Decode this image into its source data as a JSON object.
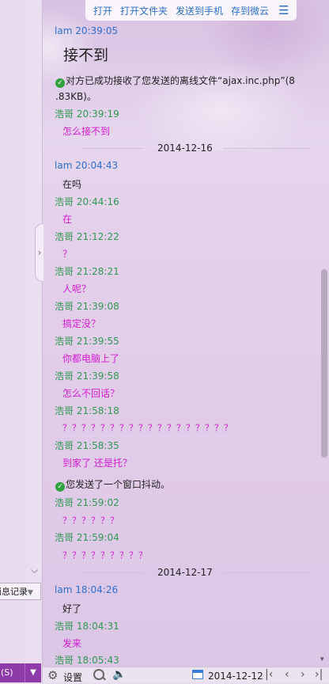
{
  "file_toolbar": {
    "open": "打开",
    "open_folder": "打开文件夹",
    "send_phone": "发送到手机",
    "save_cloud": "存到微云"
  },
  "left": {
    "history": "消息记录",
    "send_fragment": "(S)"
  },
  "messages": [
    {
      "sender": "lam",
      "time": "20:39:05",
      "text": "接不到",
      "role": "me",
      "big": true
    },
    {
      "system": true,
      "text1": "对方已成功接收了您发送的离线文件“ajax.inc.php”(8",
      "text2": ".83KB)。"
    },
    {
      "sender": "浩哥",
      "time": "20:39:19",
      "text": "怎么接不到",
      "role": "peer"
    },
    {
      "date": "2014-12-16"
    },
    {
      "sender": "lam",
      "time": "20:04:43",
      "text": "在吗",
      "role": "me"
    },
    {
      "sender": "浩哥",
      "time": "20:44:16",
      "text": "在",
      "role": "peer"
    },
    {
      "sender": "浩哥",
      "time": "21:12:22",
      "text": "？",
      "role": "peer"
    },
    {
      "sender": "浩哥",
      "time": "21:28:21",
      "text": "人呢？",
      "role": "peer"
    },
    {
      "sender": "浩哥",
      "time": "21:39:08",
      "text": "搞定没？",
      "role": "peer"
    },
    {
      "sender": "浩哥",
      "time": "21:39:55",
      "text": "你都电脑上了",
      "role": "peer"
    },
    {
      "sender": "浩哥",
      "time": "21:39:58",
      "text": "怎么不回话？",
      "role": "peer"
    },
    {
      "sender": "浩哥",
      "time": "21:58:18",
      "text": "？？？？？？？？？？？？？？？？？？",
      "role": "peer"
    },
    {
      "sender": "浩哥",
      "time": "21:58:35",
      "text": "到家了 还是托？",
      "role": "peer"
    },
    {
      "system": true,
      "text1": "您发送了一个窗口抖动。"
    },
    {
      "sender": "浩哥",
      "time": "21:59:02",
      "text": "？？？？？？",
      "role": "peer"
    },
    {
      "sender": "浩哥",
      "time": "21:59:04",
      "text": "？？？？？？？？？",
      "role": "peer"
    },
    {
      "date": "2014-12-17"
    },
    {
      "sender": "lam",
      "time": "18:04:26",
      "text": "好了",
      "role": "me"
    },
    {
      "sender": "浩哥",
      "time": "18:04:31",
      "text": "发来",
      "role": "peer"
    },
    {
      "sender": "浩哥",
      "time": "18:05:43",
      "text": "",
      "role": "peer"
    }
  ],
  "bottom": {
    "settings": "设置",
    "date": "2014-12-12"
  }
}
